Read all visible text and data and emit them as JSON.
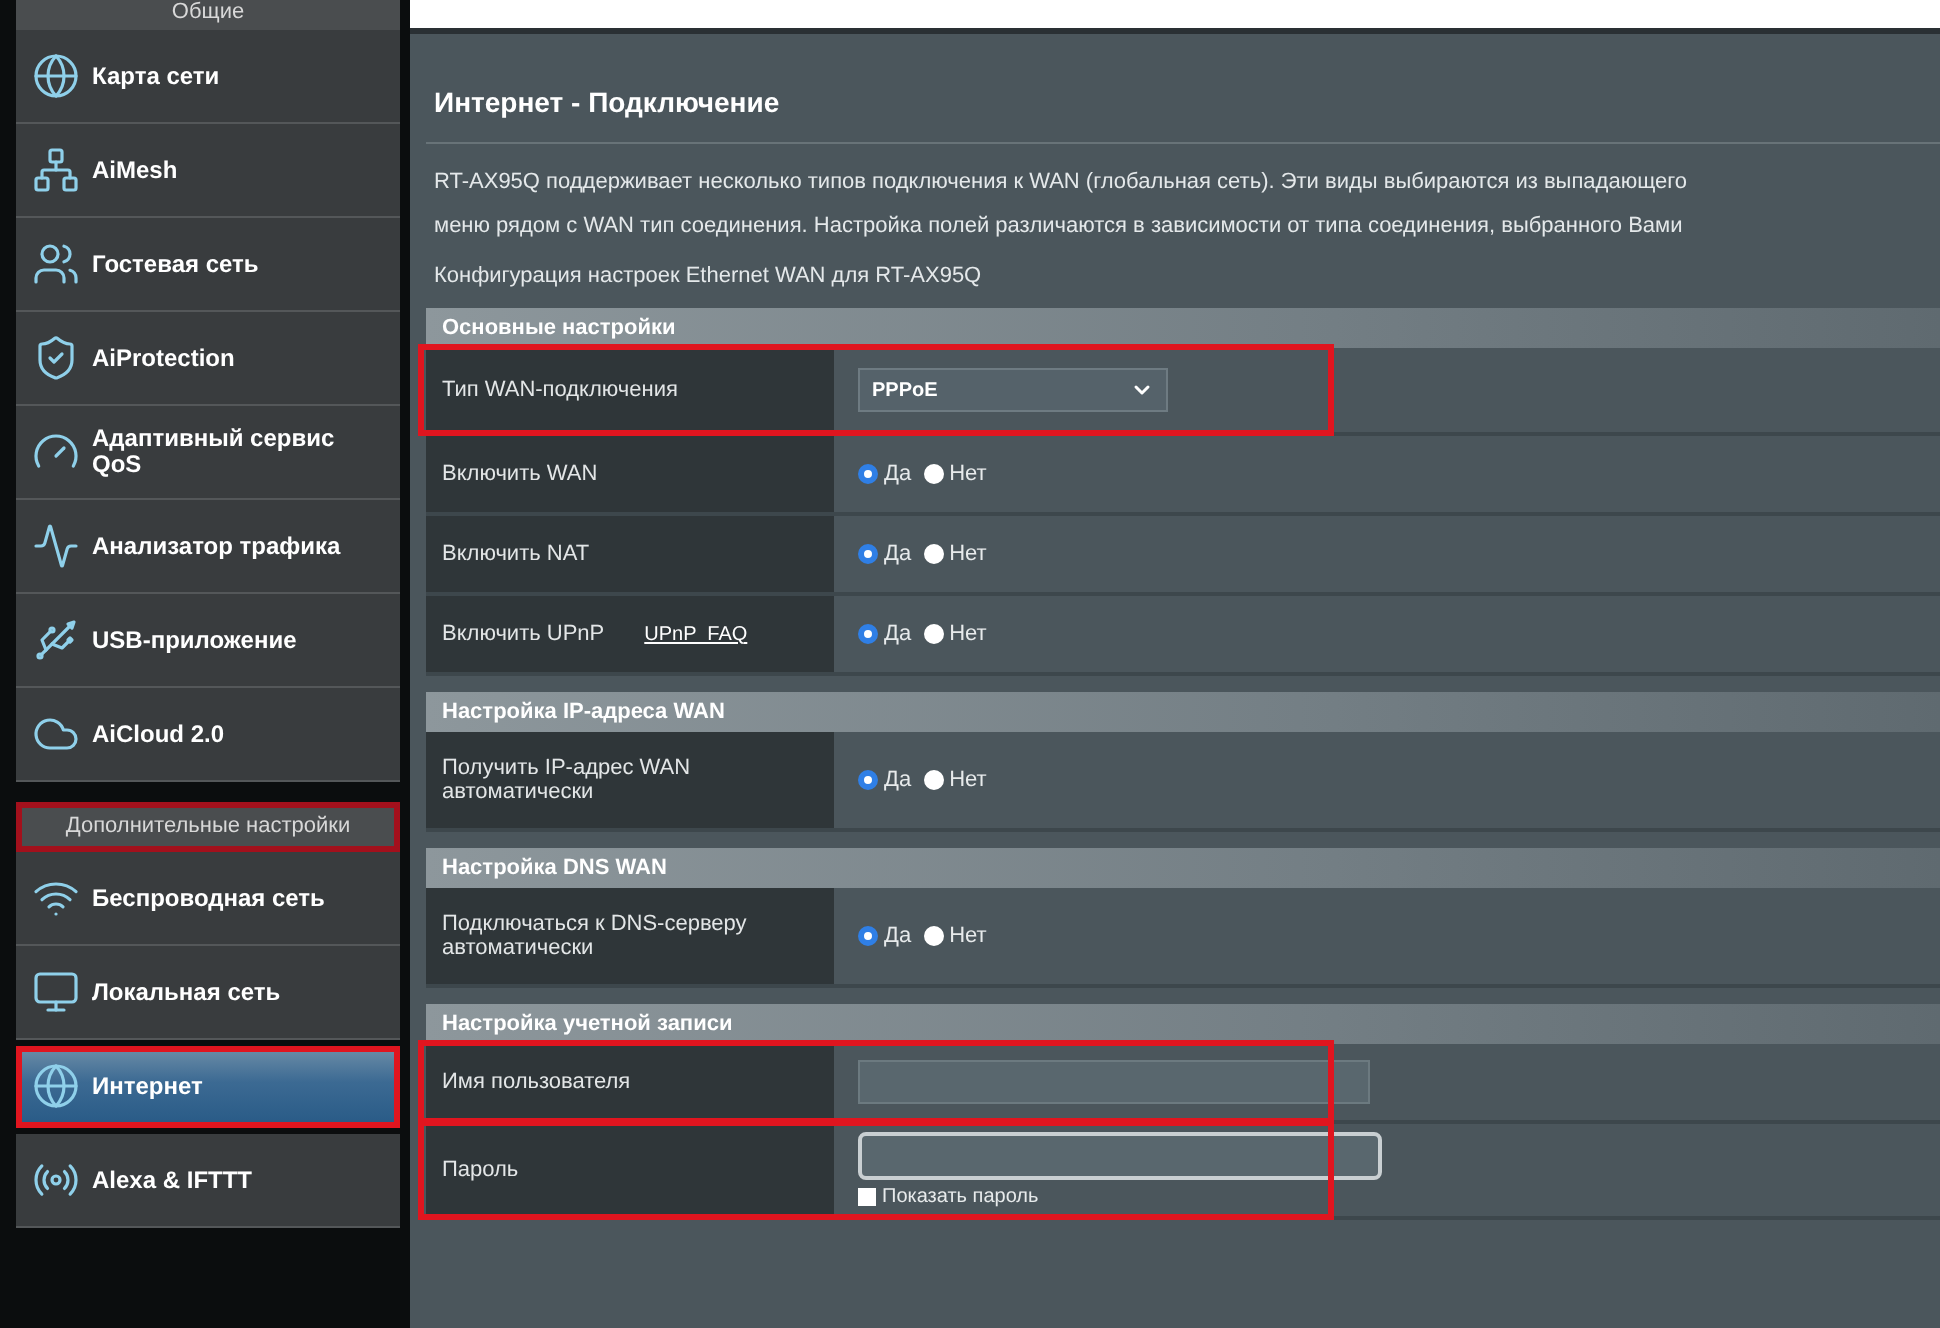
{
  "sidebar": {
    "groups": [
      {
        "title": "Общие",
        "highlighted": false,
        "items": [
          {
            "label": "Карта сети",
            "selected": false,
            "highlighted": false
          },
          {
            "label": "AiMesh",
            "selected": false,
            "highlighted": false
          },
          {
            "label": "Гостевая сеть",
            "selected": false,
            "highlighted": false
          },
          {
            "label": "AiProtection",
            "selected": false,
            "highlighted": false
          },
          {
            "label": "Адаптивный сервис QoS",
            "selected": false,
            "highlighted": false
          },
          {
            "label": "Анализатор трафика",
            "selected": false,
            "highlighted": false
          },
          {
            "label": "USB-приложение",
            "selected": false,
            "highlighted": false
          },
          {
            "label": "AiCloud 2.0",
            "selected": false,
            "highlighted": false
          }
        ]
      },
      {
        "title": "Дополнительные настройки",
        "highlighted": true,
        "items": [
          {
            "label": "Беспроводная сеть",
            "selected": false,
            "highlighted": false
          },
          {
            "label": "Локальная сеть",
            "selected": false,
            "highlighted": false
          },
          {
            "label": "Интернет",
            "selected": true,
            "highlighted": true
          },
          {
            "label": "Alexa & IFTTT",
            "selected": false,
            "highlighted": false
          }
        ]
      }
    ]
  },
  "main": {
    "title": "Интернет - Подключение",
    "description": [
      "RT-AX95Q поддерживает несколько типов подключения к WAN (глобальная сеть). Эти виды выбираются из выпадающего",
      "меню рядом с WAN тип соединения. Настройка полей различаются в зависимости от типа соединения, выбранного Вами"
    ],
    "config_note": "Конфигурация настроек Ethernet WAN для RT-AX95Q",
    "sections": [
      {
        "title": "Основные настройки",
        "rows": [
          {
            "kind": "select",
            "label": "Тип WAN-подключения",
            "value": "PPPoE",
            "highlighted": true
          },
          {
            "kind": "radio",
            "label": "Включить WAN",
            "options": [
              {
                "label": "Да",
                "selected": true
              },
              {
                "label": "Нет",
                "selected": false
              }
            ]
          },
          {
            "kind": "radio",
            "label": "Включить NAT",
            "options": [
              {
                "label": "Да",
                "selected": true
              },
              {
                "label": "Нет",
                "selected": false
              }
            ]
          },
          {
            "kind": "radio",
            "label": "Включить UPnP",
            "link": "UPnP  FAQ",
            "options": [
              {
                "label": "Да",
                "selected": true
              },
              {
                "label": "Нет",
                "selected": false
              }
            ]
          }
        ]
      },
      {
        "title": "Настройка IP-адреса WAN",
        "rows": [
          {
            "kind": "radio",
            "label": "Получить IP-адрес WAN автоматически",
            "options": [
              {
                "label": "Да",
                "selected": true
              },
              {
                "label": "Нет",
                "selected": false
              }
            ]
          }
        ]
      },
      {
        "title": "Настройка DNS WAN",
        "rows": [
          {
            "kind": "radio",
            "label": "Подключаться к DNS-серверу автоматически",
            "options": [
              {
                "label": "Да",
                "selected": true
              },
              {
                "label": "Нет",
                "selected": false
              }
            ]
          }
        ]
      },
      {
        "title": "Настройка учетной записи",
        "highlighted": true,
        "rows": [
          {
            "kind": "text",
            "label": "Имя пользователя"
          },
          {
            "kind": "password",
            "label": "Пароль",
            "checkbox": {
              "label": "Показать пароль",
              "checked": false
            }
          }
        ]
      }
    ]
  }
}
